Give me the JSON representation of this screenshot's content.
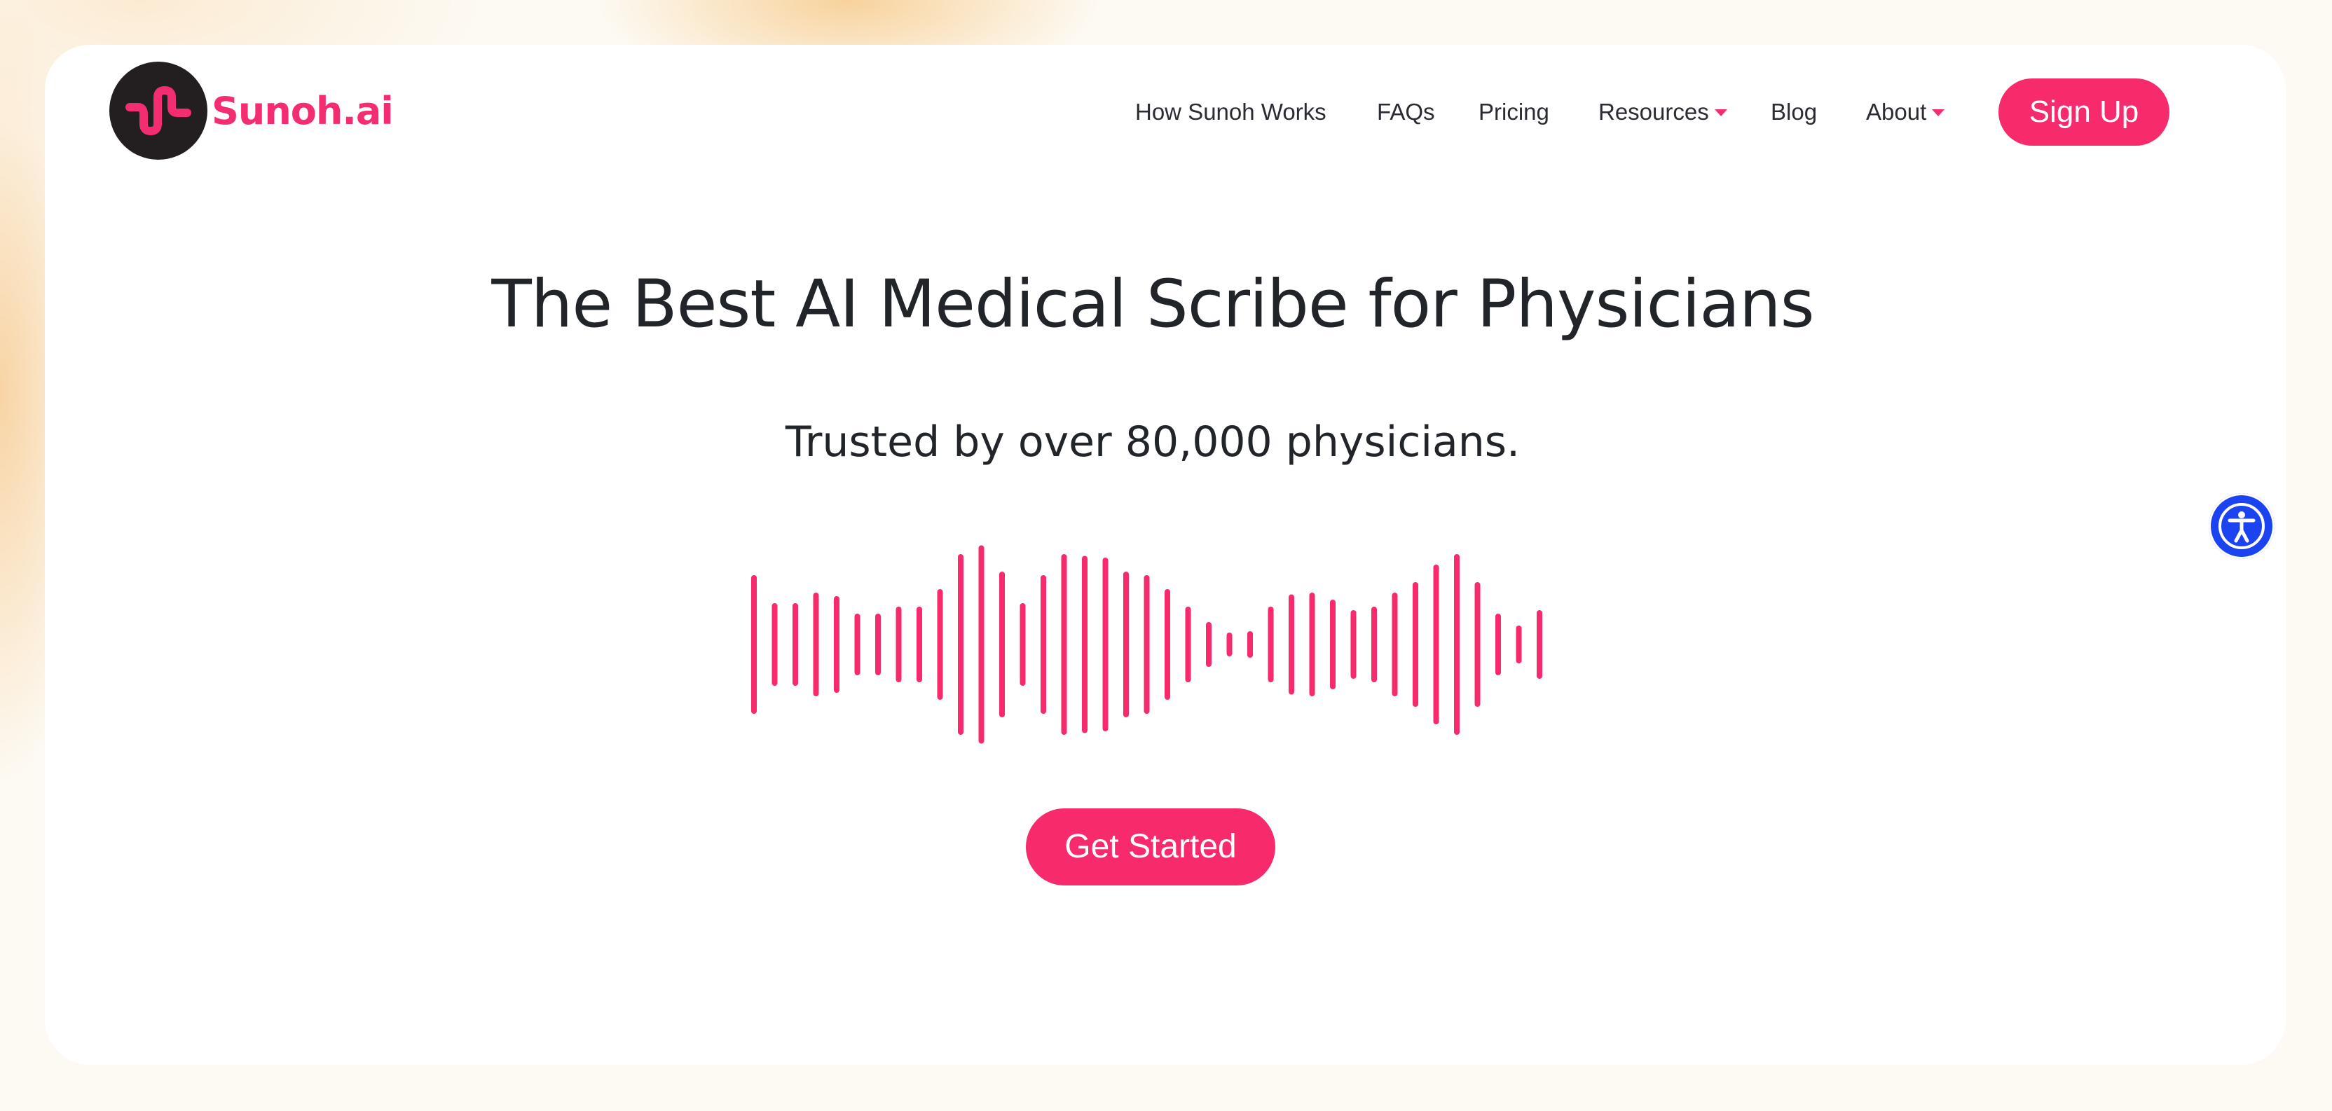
{
  "brand": {
    "name": "Sunoh.ai",
    "accent_color": "#f72a6b",
    "logo_icon": "wave-squiggle-icon"
  },
  "nav": {
    "items": [
      {
        "label": "How Sunoh Works",
        "dropdown": false
      },
      {
        "label": "FAQs",
        "dropdown": false
      },
      {
        "label": "Pricing",
        "dropdown": false
      },
      {
        "label": "Resources",
        "dropdown": true
      },
      {
        "label": "Blog",
        "dropdown": false
      },
      {
        "label": "About",
        "dropdown": true
      }
    ],
    "signup_label": "Sign Up"
  },
  "hero": {
    "title": "The Best AI Medical Scribe for Physicians",
    "subtitle": "Trusted by over 80,000 physicians.",
    "waveform_icon": "audio-waveform-icon",
    "cta_label": "Get Started"
  },
  "accessibility": {
    "icon": "accessibility-icon",
    "color": "#1b44f0"
  }
}
